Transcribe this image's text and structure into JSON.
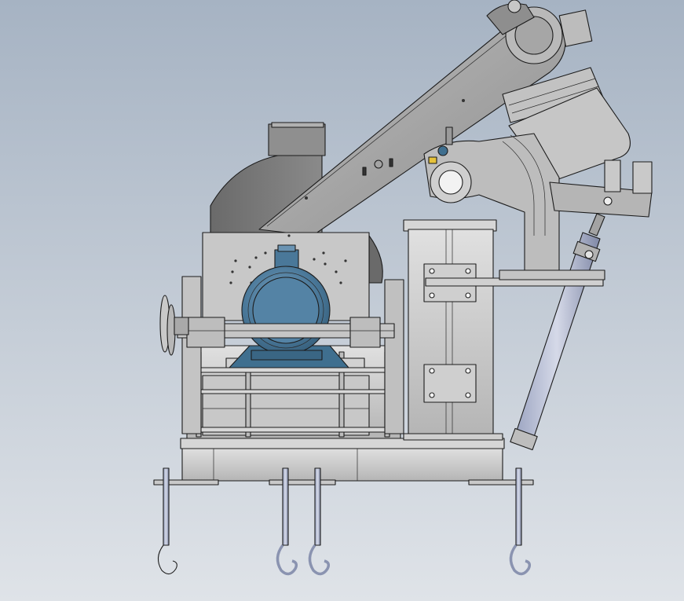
{
  "viewport": {
    "background_top": "#a6b3c3",
    "background_bottom": "#dfe3e8"
  },
  "colors": {
    "steel_light": "#d2d2d2",
    "steel_mid": "#a9a9a9",
    "steel_dark": "#7c7c7c",
    "chute_dark": "#6d6d6d",
    "motor_blue": "#3f6f8f",
    "motor_blue_light": "#6a93b2",
    "rod_blue": "#8c95b4",
    "accent_yellow": "#e6c23a"
  },
  "model": {
    "description_text": "",
    "icons": [
      "motor",
      "conveyor-belt",
      "pneumatic-cylinder",
      "anchor-bolt",
      "handwheel",
      "hopper"
    ]
  }
}
